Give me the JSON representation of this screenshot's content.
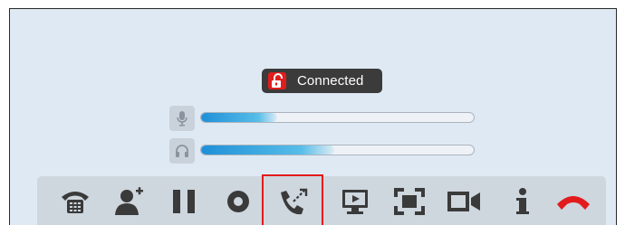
{
  "call": {
    "status_text": "Connected",
    "status_icon": "lock-open-icon",
    "mic_level": 0.28,
    "speaker_level": 0.49,
    "mic_icon": "microphone-icon",
    "speaker_icon": "headphones-icon"
  },
  "toolbar": {
    "buttons": [
      {
        "name": "dialpad-button",
        "icon": "phone-dialpad-icon"
      },
      {
        "name": "add-participant-button",
        "icon": "add-user-icon"
      },
      {
        "name": "hold-button",
        "icon": "pause-icon"
      },
      {
        "name": "record-button",
        "icon": "record-icon"
      },
      {
        "name": "transfer-button",
        "icon": "call-transfer-icon",
        "selected": true
      },
      {
        "name": "screen-share-button",
        "icon": "monitor-icon"
      },
      {
        "name": "fullscreen-button",
        "icon": "fullscreen-icon"
      },
      {
        "name": "video-button",
        "icon": "video-camera-icon"
      },
      {
        "name": "info-button",
        "icon": "info-icon"
      },
      {
        "name": "hangup-button",
        "icon": "hang-up-icon"
      }
    ]
  },
  "colors": {
    "background": "#dfe9f3",
    "toolbar": "#ced6de",
    "icon": "#3a3a3a",
    "accent_red": "#e21c1c",
    "meter_blue": "#1f8fd8"
  }
}
